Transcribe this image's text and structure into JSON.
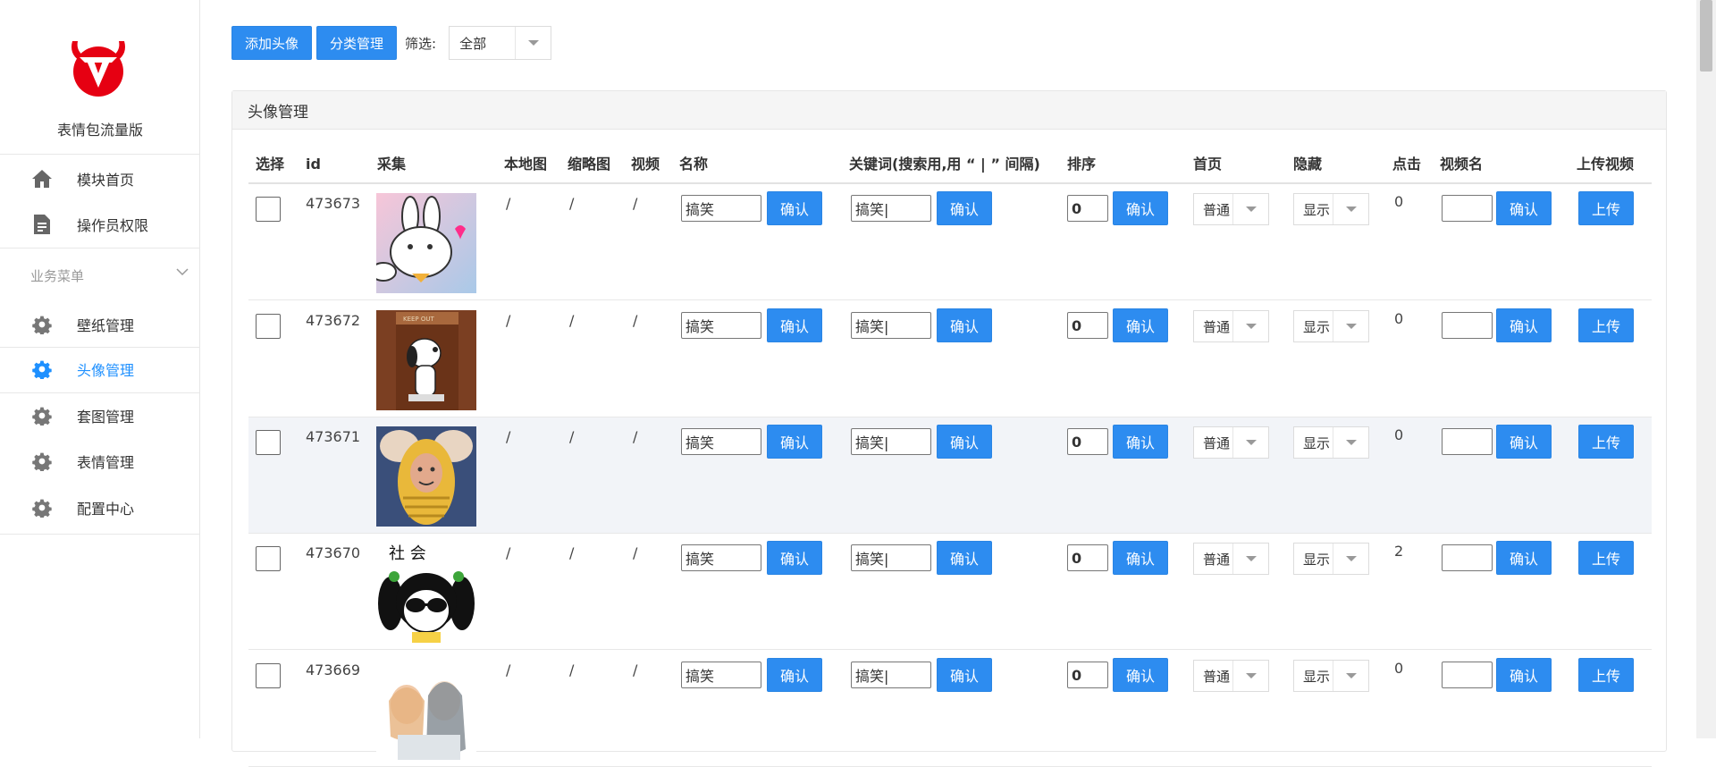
{
  "sidebar": {
    "brand": "表情包流量版",
    "items_top": [
      {
        "label": "模块首页",
        "icon": "home-icon"
      },
      {
        "label": "操作员权限",
        "icon": "document-icon"
      }
    ],
    "group_label": "业务菜单",
    "items": [
      {
        "label": "壁纸管理",
        "icon": "gear-icon",
        "active": false
      },
      {
        "label": "头像管理",
        "icon": "gear-icon",
        "active": true
      },
      {
        "label": "套图管理",
        "icon": "gear-icon",
        "active": false
      },
      {
        "label": "表情管理",
        "icon": "gear-icon",
        "active": false
      },
      {
        "label": "配置中心",
        "icon": "gear-icon",
        "active": false
      }
    ]
  },
  "toolbar": {
    "add_label": "添加头像",
    "category_label": "分类管理",
    "filter_label": "筛选:",
    "filter_value": "全部"
  },
  "panel": {
    "title": "头像管理"
  },
  "table": {
    "columns": [
      "选择",
      "id",
      "采集",
      "本地图",
      "缩略图",
      "视频",
      "名称",
      "关键词(搜索用,用 “ | ” 间隔)",
      "排序",
      "首页",
      "隐藏",
      "点击",
      "视频名",
      "上传视频"
    ],
    "confirm_label": "确认",
    "upload_label": "上传",
    "rows": [
      {
        "id": "473673",
        "local": "/",
        "thumb": "/",
        "video": "/",
        "name": "搞笑",
        "keywords": "搞笑|",
        "sort": "0",
        "home": "普通",
        "hide": "显示",
        "clicks": "0",
        "video_name": "",
        "image": "bunny"
      },
      {
        "id": "473672",
        "local": "/",
        "thumb": "/",
        "video": "/",
        "name": "搞笑",
        "keywords": "搞笑|",
        "sort": "0",
        "home": "普通",
        "hide": "显示",
        "clicks": "0",
        "video_name": "",
        "image": "snoopy",
        "image_text": "KEEP OUT"
      },
      {
        "id": "473671",
        "local": "/",
        "thumb": "/",
        "video": "/",
        "name": "搞笑",
        "keywords": "搞笑|",
        "sort": "0",
        "home": "普通",
        "hide": "显示",
        "clicks": "0",
        "video_name": "",
        "image": "corn"
      },
      {
        "id": "473670",
        "local": "/",
        "thumb": "/",
        "video": "/",
        "name": "搞笑",
        "keywords": "搞笑|",
        "sort": "0",
        "home": "普通",
        "hide": "显示",
        "clicks": "2",
        "video_name": "",
        "image": "cartoon",
        "image_text": "社   会"
      },
      {
        "id": "473669",
        "local": "/",
        "thumb": "/",
        "video": "/",
        "name": "搞笑",
        "keywords": "搞笑|",
        "sort": "0",
        "home": "普通",
        "hide": "显示",
        "clicks": "0",
        "video_name": "",
        "image": "sketch"
      }
    ]
  },
  "colors": {
    "primary": "#2d8cf0",
    "active_text": "#1e90ff",
    "logo_red": "#e60012"
  }
}
